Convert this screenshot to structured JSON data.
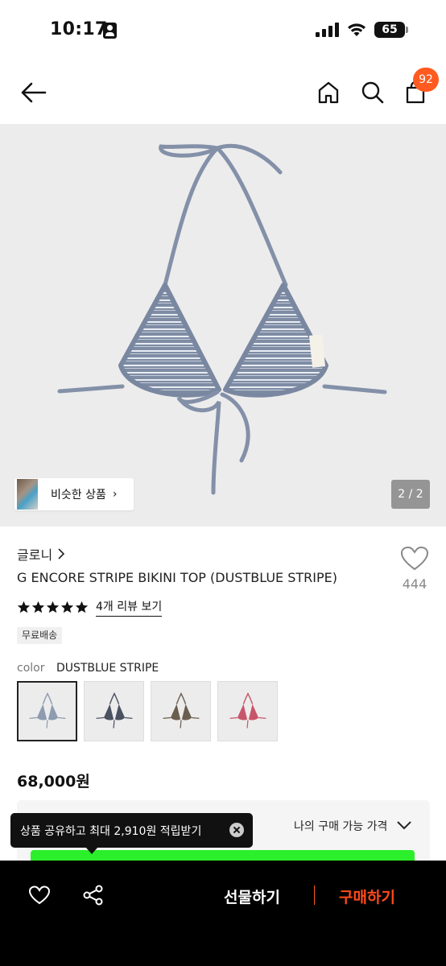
{
  "status_bar": {
    "time": "10:17",
    "battery": "65"
  },
  "header": {
    "cart_count": "92"
  },
  "product_image": {
    "similar_label": "비슷한 상품",
    "page_indicator": "2 / 2"
  },
  "product": {
    "brand": "글로니",
    "title": "G ENCORE STRIPE BIKINI TOP (DUSTBLUE STRIPE)",
    "wish_count": "444",
    "rating_stars": 5,
    "review_link": "4개 리뷰 보기",
    "shipping_badge": "무료배송",
    "color_label": "color",
    "color_value": "DUSTBLUE STRIPE",
    "swatches": [
      {
        "name": "dustblue",
        "color": "#8e9bb0"
      },
      {
        "name": "charcoal",
        "color": "#4a5160"
      },
      {
        "name": "brown",
        "color": "#6b5e4f"
      },
      {
        "name": "pink",
        "color": "#c8566a"
      }
    ],
    "price": "68,000원"
  },
  "my_price": {
    "label": "나의 구매 가능 가격"
  },
  "tooltip": {
    "text": "상품 공유하고 최대 2,910원 적립받기"
  },
  "bottom_bar": {
    "gift_label": "선물하기",
    "buy_label": "구매하기"
  },
  "colors": {
    "accent": "#ff5a1f",
    "green": "#2bef2b"
  }
}
